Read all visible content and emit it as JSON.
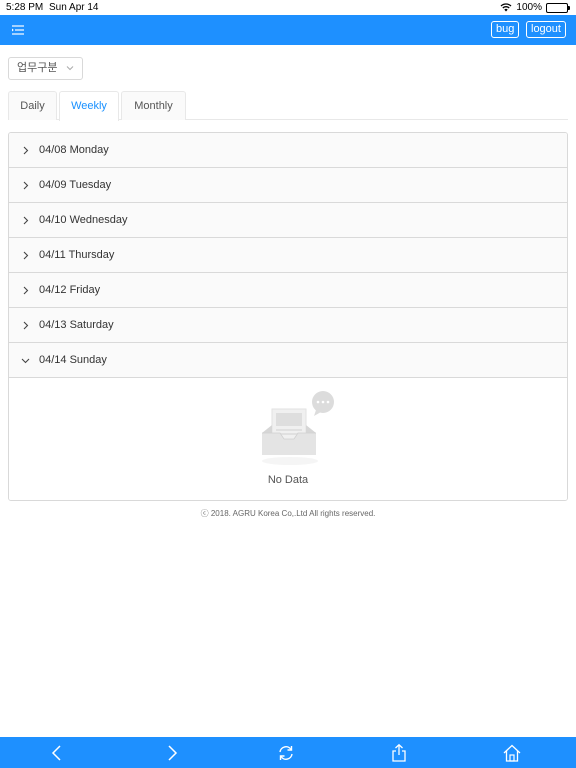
{
  "status_bar": {
    "time": "5:28 PM",
    "date": "Sun Apr 14",
    "battery": "100%"
  },
  "header": {
    "bug_label": "bug",
    "logout_label": "logout"
  },
  "filter": {
    "selected": "업무구분"
  },
  "tabs": [
    {
      "label": "Daily",
      "active": false
    },
    {
      "label": "Weekly",
      "active": true
    },
    {
      "label": "Monthly",
      "active": false
    }
  ],
  "days": [
    {
      "label": "04/08 Monday",
      "expanded": false
    },
    {
      "label": "04/09 Tuesday",
      "expanded": false
    },
    {
      "label": "04/10 Wednesday",
      "expanded": false
    },
    {
      "label": "04/11 Thursday",
      "expanded": false
    },
    {
      "label": "04/12 Friday",
      "expanded": false
    },
    {
      "label": "04/13 Saturday",
      "expanded": false
    },
    {
      "label": "04/14 Sunday",
      "expanded": true
    }
  ],
  "empty_state": {
    "text": "No Data",
    "icon": "empty-inbox-icon"
  },
  "footer": {
    "copyright": "ⓒ 2018. AGRU Korea Co,.Ltd All rights reserved."
  },
  "toolbar": {
    "icons": [
      "back-icon",
      "forward-icon",
      "refresh-icon",
      "share-icon",
      "home-icon"
    ]
  },
  "colors": {
    "accent": "#1e90ff",
    "tab_active": "#1890ff",
    "panel_bg": "#fafafa",
    "border": "#d9d9d9"
  }
}
